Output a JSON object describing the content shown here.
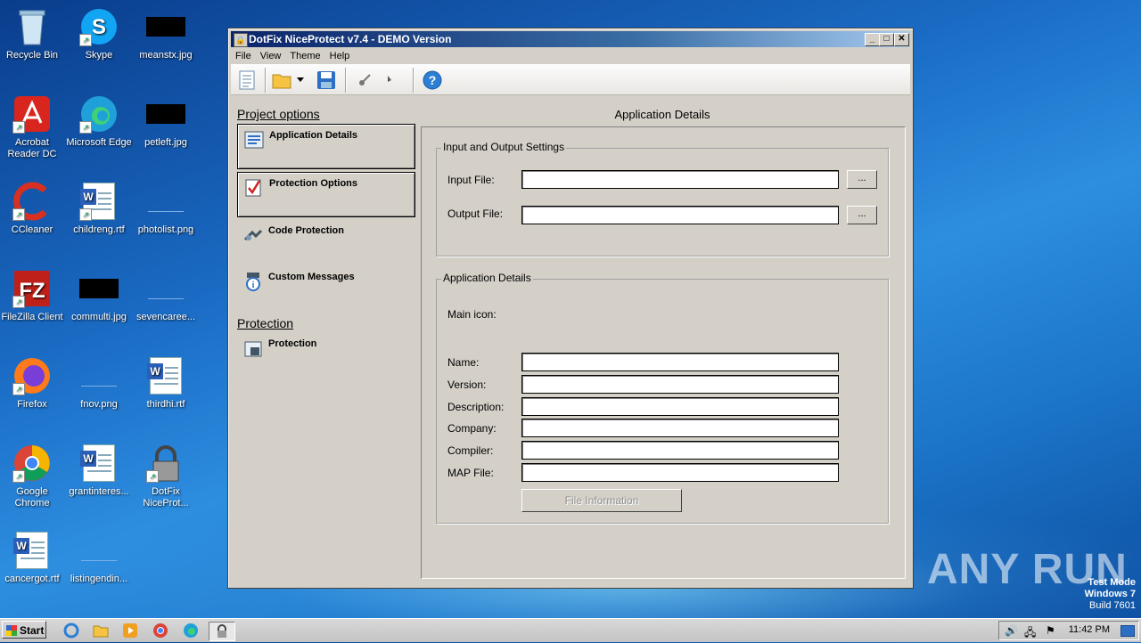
{
  "desktop": {
    "icons": [
      {
        "label": "Recycle Bin",
        "icon": "recycle-bin-icon"
      },
      {
        "label": "Skype",
        "icon": "skype-icon"
      },
      {
        "label": "meanstx.jpg",
        "icon": "image-file-icon"
      },
      {
        "label": "Acrobat Reader DC",
        "icon": "acrobat-icon"
      },
      {
        "label": "Microsoft Edge",
        "icon": "edge-icon"
      },
      {
        "label": "petleft.jpg",
        "icon": "image-file-icon"
      },
      {
        "label": "CCleaner",
        "icon": "ccleaner-icon"
      },
      {
        "label": "childreng.rtf",
        "icon": "word-doc-icon"
      },
      {
        "label": "photolist.png",
        "icon": "image-file-icon"
      },
      {
        "label": "FileZilla Client",
        "icon": "filezilla-icon"
      },
      {
        "label": "commulti.jpg",
        "icon": "image-file-icon"
      },
      {
        "label": "sevencaree...",
        "icon": "image-file-icon"
      },
      {
        "label": "Firefox",
        "icon": "firefox-icon"
      },
      {
        "label": "fnov.png",
        "icon": "image-file-icon"
      },
      {
        "label": "thirdhi.rtf",
        "icon": "word-doc-icon"
      },
      {
        "label": "Google Chrome",
        "icon": "chrome-icon"
      },
      {
        "label": "grantinteres...",
        "icon": "word-doc-icon"
      },
      {
        "label": "DotFix NiceProt...",
        "icon": "niceprotect-icon"
      },
      {
        "label": "cancergot.rtf",
        "icon": "word-doc-icon"
      },
      {
        "label": "listingendin...",
        "icon": "image-file-icon"
      }
    ]
  },
  "window": {
    "title": "DotFix NiceProtect v7.4 - DEMO Version",
    "menu": [
      "File",
      "View",
      "Theme",
      "Help"
    ],
    "toolbar": [
      "new-icon",
      "open-folder-icon",
      "save-icon",
      "key-icon",
      "help-icon"
    ]
  },
  "left": {
    "project_options_title": "Project options",
    "items": [
      {
        "label": "Application Details",
        "icon": "app-details-icon"
      },
      {
        "label": "Protection Options",
        "icon": "checkmark-icon"
      },
      {
        "label": "Code Protection",
        "icon": "code-protection-icon"
      },
      {
        "label": "Custom Messages",
        "icon": "info-icon"
      }
    ],
    "protection_title": "Protection",
    "protection_item": "Protection"
  },
  "main": {
    "title": "Application Details",
    "io_group": {
      "title": "Input and Output Settings",
      "input_label": "Input File:",
      "input_value": "",
      "output_label": "Output File:",
      "output_value": "",
      "browse_label": "..."
    },
    "details_group": {
      "title": "Application Details",
      "main_icon_label": "Main icon:",
      "fields": [
        {
          "label": "Name:",
          "value": ""
        },
        {
          "label": "Version:",
          "value": ""
        },
        {
          "label": "Description:",
          "value": ""
        },
        {
          "label": "Company:",
          "value": ""
        },
        {
          "label": "Compiler:",
          "value": ""
        },
        {
          "label": "MAP File:",
          "value": ""
        }
      ],
      "file_info_button": "File Information"
    }
  },
  "taskbar": {
    "start": "Start",
    "clock": "11:42 PM"
  },
  "watermark": {
    "line1": "Test Mode",
    "line2": "Windows 7",
    "line3": "Build 7601",
    "brand": "ANY RUN"
  }
}
